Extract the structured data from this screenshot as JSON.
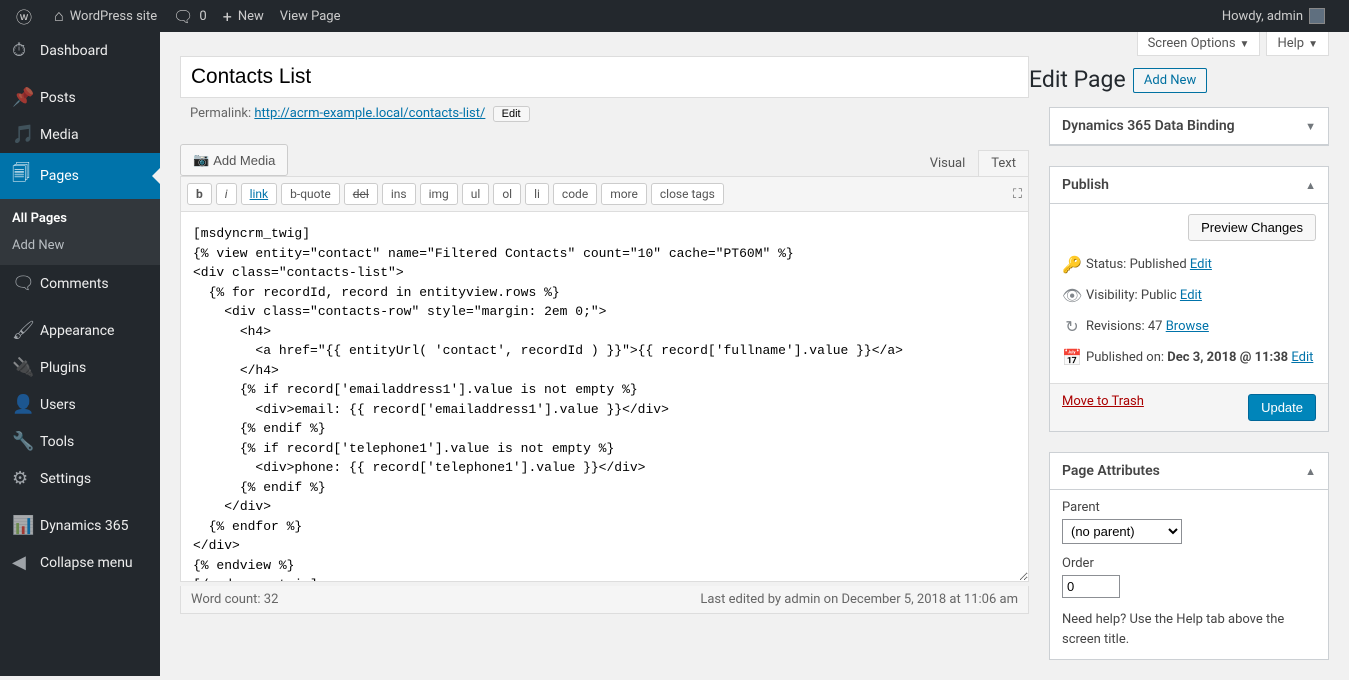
{
  "adminbar": {
    "site_name": "WordPress site",
    "comments": "0",
    "new": "New",
    "view_page": "View Page",
    "greeting": "Howdy, admin"
  },
  "menu": {
    "dashboard": "Dashboard",
    "posts": "Posts",
    "media": "Media",
    "pages": "Pages",
    "all_pages": "All Pages",
    "add_new": "Add New",
    "comments": "Comments",
    "appearance": "Appearance",
    "plugins": "Plugins",
    "users": "Users",
    "tools": "Tools",
    "settings": "Settings",
    "dynamics": "Dynamics 365",
    "collapse": "Collapse menu"
  },
  "screen_options": "Screen Options",
  "help": "Help",
  "heading": "Edit Page",
  "add_new_button": "Add New",
  "title": "Contacts List",
  "permalink": {
    "label": "Permalink:",
    "url": "http://acrm-example.local/contacts-list/",
    "edit": "Edit"
  },
  "media_button": "Add Media",
  "tabs": {
    "visual": "Visual",
    "text": "Text"
  },
  "qt": {
    "b": "b",
    "i": "i",
    "link": "link",
    "bquote": "b-quote",
    "del": "del",
    "ins": "ins",
    "img": "img",
    "ul": "ul",
    "ol": "ol",
    "li": "li",
    "code": "code",
    "more": "more",
    "close": "close tags"
  },
  "content": "[msdyncrm_twig]\n{% view entity=\"contact\" name=\"Filtered Contacts\" count=\"10\" cache=\"PT60M\" %}\n<div class=\"contacts-list\">\n  {% for recordId, record in entityview.rows %}\n    <div class=\"contacts-row\" style=\"margin: 2em 0;\">\n      <h4>\n        <a href=\"{{ entityUrl( 'contact', recordId ) }}\">{{ record['fullname'].value }}</a>\n      </h4>\n      {% if record['emailaddress1'].value is not empty %}\n        <div>email: {{ record['emailaddress1'].value }}</div>\n      {% endif %}\n      {% if record['telephone1'].value is not empty %}\n        <div>phone: {{ record['telephone1'].value }}</div>\n      {% endif %}\n    </div>\n  {% endfor %}\n</div>\n{% endview %}\n[/msdyncrm_twig]",
  "word_count": "Word count: 32",
  "last_edit": "Last edited by admin on December 5, 2018 at 11:06 am",
  "box_databinding": "Dynamics 365 Data Binding",
  "publish": {
    "title": "Publish",
    "preview": "Preview Changes",
    "status_label": "Status:",
    "status_value": "Published",
    "status_edit": "Edit",
    "visibility_label": "Visibility:",
    "visibility_value": "Public",
    "visibility_edit": "Edit",
    "revisions_label": "Revisions:",
    "revisions_value": "47",
    "revisions_browse": "Browse",
    "published_label": "Published on:",
    "published_value": "Dec 3, 2018 @ 11:38",
    "published_edit": "Edit",
    "trash": "Move to Trash",
    "update": "Update"
  },
  "page_attr": {
    "title": "Page Attributes",
    "parent_label": "Parent",
    "parent_value": "(no parent)",
    "order_label": "Order",
    "order_value": "0",
    "help_text": "Need help? Use the Help tab above the screen title."
  }
}
